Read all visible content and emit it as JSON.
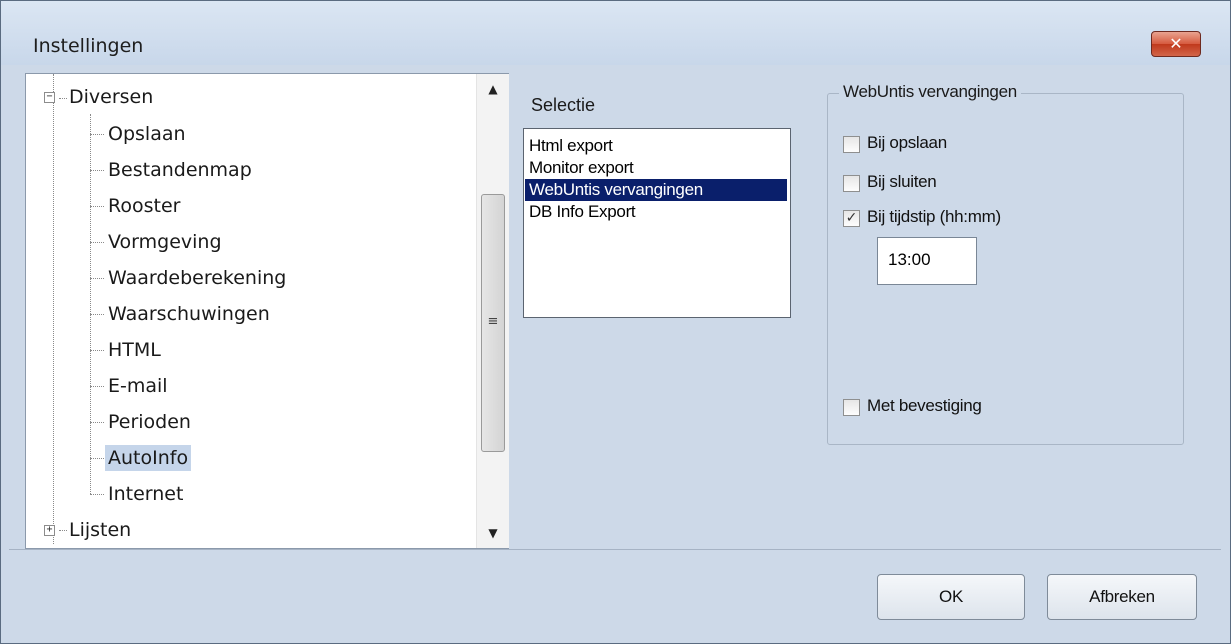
{
  "window": {
    "title": "Instellingen",
    "close_glyph": "✕"
  },
  "tree": {
    "groups": [
      {
        "label": "Diversen",
        "expanded": true,
        "expander": "−",
        "children": [
          "Opslaan",
          "Bestandenmap",
          "Rooster",
          "Vormgeving",
          "Waardeberekening",
          "Waarschuwingen",
          "HTML",
          "E-mail",
          "Perioden",
          "AutoInfo",
          "Internet"
        ],
        "selected_child": "AutoInfo"
      },
      {
        "label": "Lijsten",
        "expanded": false,
        "expander": "+"
      }
    ],
    "scrollbar": {
      "up_icon": "▲",
      "down_icon": "▼",
      "grip_icon": "≡"
    }
  },
  "selectie": {
    "label": "Selectie",
    "items": [
      "Html export",
      "Monitor export",
      "WebUntis vervangingen",
      "DB Info Export"
    ],
    "selected_index": 2
  },
  "webuntis": {
    "title": "WebUntis vervangingen",
    "bij_opslaan": {
      "label": "Bij opslaan",
      "checked": false
    },
    "bij_sluiten": {
      "label": "Bij sluiten",
      "checked": false
    },
    "bij_tijdstip": {
      "label": "Bij tijdstip (hh:mm)",
      "checked": true,
      "glyph": "✓"
    },
    "time_value": "13:00",
    "met_bevestiging": {
      "label": "Met bevestiging",
      "checked": false
    }
  },
  "buttons": {
    "ok": "OK",
    "cancel": "Afbreken"
  },
  "colors": {
    "selection_bg": "#0a1f6b",
    "tree_selection_bg": "#c5d5ea",
    "dialog_bg": "#cdd9e8",
    "close_button": "#c0391c"
  }
}
